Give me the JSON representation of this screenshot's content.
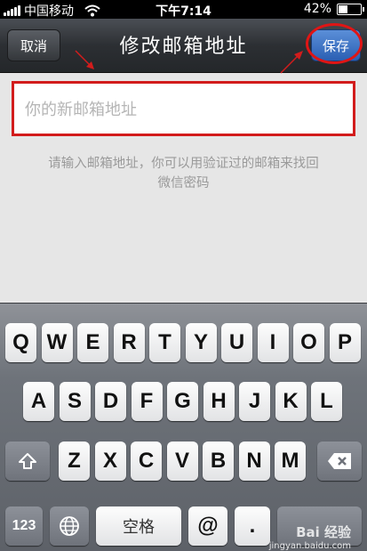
{
  "status_bar": {
    "carrier": "中国移动",
    "time": "下午7:14",
    "battery": "42%"
  },
  "nav": {
    "title": "修改邮箱地址",
    "cancel_label": "取消",
    "save_label": "保存"
  },
  "form": {
    "email_value": "",
    "email_placeholder": "你的新邮箱地址",
    "hint_line1": "请输入邮箱地址，你可以用验证过的邮箱来找回",
    "hint_line2": "微信密码"
  },
  "keyboard": {
    "row1": [
      "Q",
      "W",
      "E",
      "R",
      "T",
      "Y",
      "U",
      "I",
      "O",
      "P"
    ],
    "row2": [
      "A",
      "S",
      "D",
      "F",
      "G",
      "H",
      "J",
      "K",
      "L"
    ],
    "row3": [
      "Z",
      "X",
      "C",
      "V",
      "B",
      "N",
      "M"
    ],
    "numbers_label": "123",
    "space_label": "空格",
    "at_label": "@",
    "dot_label": "."
  },
  "watermark": {
    "brand": "Bai 经验",
    "url": "jingyan.baidu.com"
  },
  "colors": {
    "annotation_red": "#d21c1c",
    "save_blue": "#2a5fb3"
  }
}
